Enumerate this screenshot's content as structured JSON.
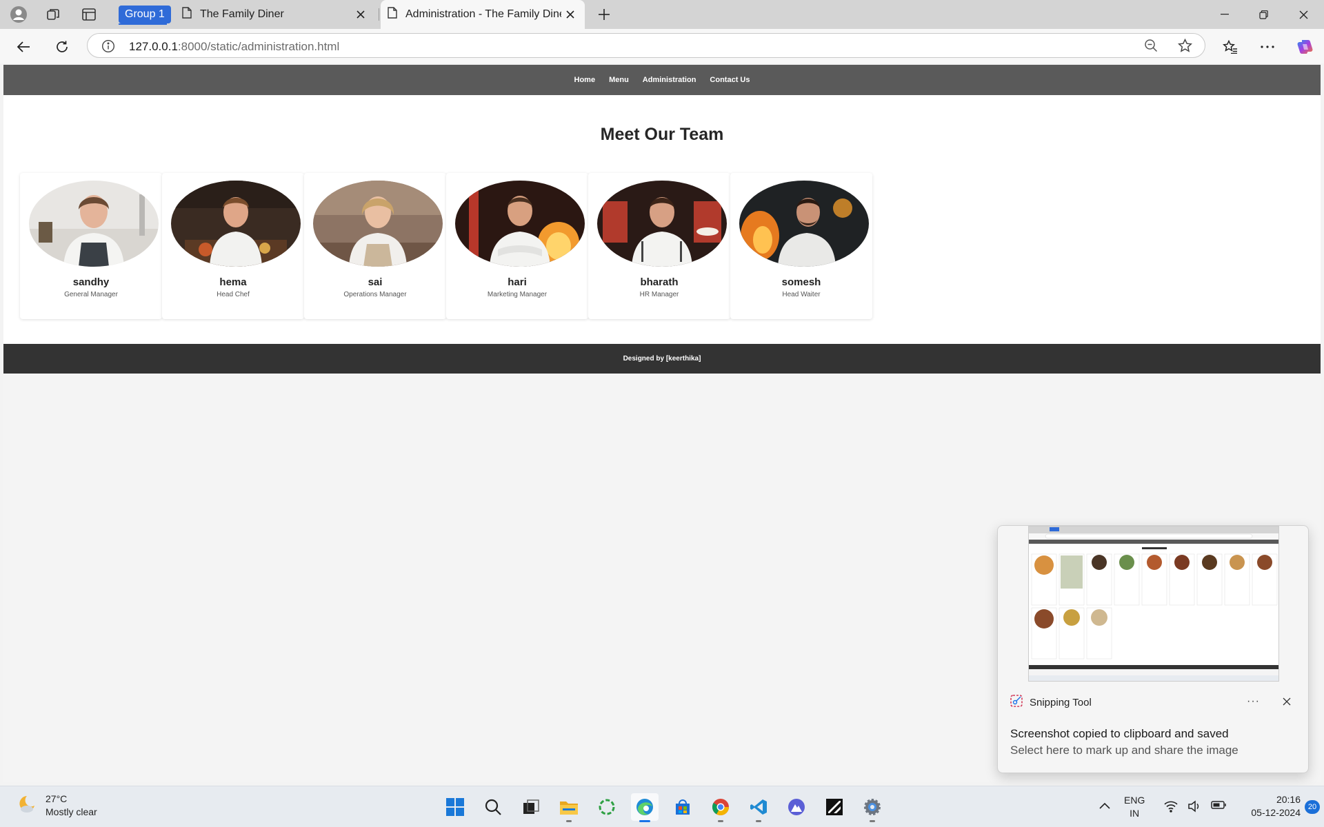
{
  "browser": {
    "tab_group_label": "Group 1",
    "tabs": [
      {
        "title": "The Family Diner",
        "active": false
      },
      {
        "title": "Administration - The Family Diner",
        "active": true
      }
    ],
    "url_host": "127.0.0.1",
    "url_rest": ":8000/static/administration.html"
  },
  "site": {
    "nav": [
      "Home",
      "Menu",
      "Administration",
      "Contact Us"
    ],
    "heading": "Meet Our Team",
    "team": [
      {
        "name": "sandhy",
        "role": "General Manager"
      },
      {
        "name": "hema",
        "role": "Head Chef"
      },
      {
        "name": "sai",
        "role": "Operations Manager"
      },
      {
        "name": "hari",
        "role": "Marketing Manager"
      },
      {
        "name": "bharath",
        "role": "HR Manager"
      },
      {
        "name": "somesh",
        "role": "Head Waiter"
      }
    ],
    "footer_prefix": "Designed by ",
    "footer_author": "[keerthika]"
  },
  "toast": {
    "app_name": "Snipping Tool",
    "more": "···",
    "title": "Screenshot copied to clipboard and saved",
    "subtitle": "Select here to mark up and share the image"
  },
  "taskbar": {
    "temperature": "27°C",
    "weather": "Mostly clear",
    "lang_top": "ENG",
    "lang_bottom": "IN",
    "time": "20:16",
    "date": "05-12-2024",
    "notifications": "20"
  },
  "colors": {
    "nav_bg": "#5a5a5a",
    "footer_bg": "#333333",
    "tab_group": "#2f6bd8",
    "accent": "#1a73e8"
  }
}
